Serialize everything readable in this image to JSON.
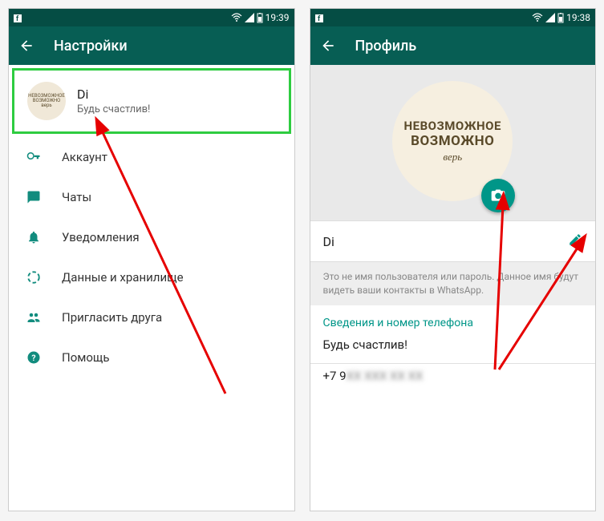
{
  "statusbar": {
    "time_left": "19:39",
    "time_right": "19:38"
  },
  "left": {
    "appbar_title": "Настройки",
    "profile": {
      "name": "Di",
      "status": "Будь счастлив!",
      "avatar_line1": "НЕВОЗМОЖНОЕ",
      "avatar_line2": "ВОЗМОЖНО",
      "avatar_line3": "верь"
    },
    "items": [
      {
        "label": "Аккаунт"
      },
      {
        "label": "Чаты"
      },
      {
        "label": "Уведомления"
      },
      {
        "label": "Данные и хранилище"
      },
      {
        "label": "Пригласить друга"
      },
      {
        "label": "Помощь"
      }
    ]
  },
  "right": {
    "appbar_title": "Профиль",
    "avatar": {
      "line1": "НЕВОЗМОЖНОЕ",
      "line2": "ВОЗМОЖНО",
      "line3": "верь"
    },
    "name": "Di",
    "hint": "Это не имя пользователя или пароль. Данное имя будут видеть ваши контакты в WhatsApp.",
    "section_title": "Сведения и номер телефона",
    "about": "Будь счастлив!",
    "phone_prefix": "+7 9",
    "phone_rest": "XX XXX XX XX"
  }
}
